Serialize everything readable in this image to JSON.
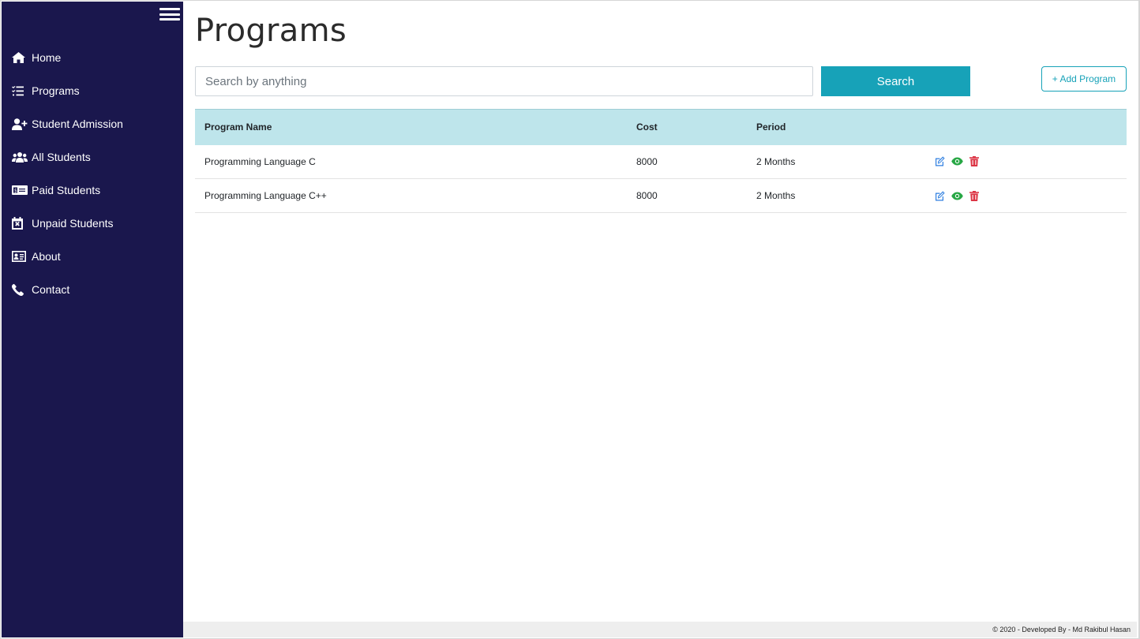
{
  "sidebar": {
    "items": [
      {
        "label": "Home",
        "icon": "home-icon"
      },
      {
        "label": "Programs",
        "icon": "list-check-icon"
      },
      {
        "label": "Student Admission",
        "icon": "user-plus-icon"
      },
      {
        "label": "All Students",
        "icon": "users-icon"
      },
      {
        "label": "Paid Students",
        "icon": "money-bill-icon"
      },
      {
        "label": "Unpaid Students",
        "icon": "calendar-times-icon"
      },
      {
        "label": "About",
        "icon": "id-card-icon"
      },
      {
        "label": "Contact",
        "icon": "phone-icon"
      }
    ]
  },
  "main": {
    "title": "Programs",
    "search": {
      "placeholder": "Search by anything",
      "value": "",
      "button_label": "Search"
    },
    "add_button_label": "+ Add Program",
    "table": {
      "columns": [
        "Program Name",
        "Cost",
        "Period",
        ""
      ],
      "rows": [
        {
          "name": "Programming Language C",
          "cost": "8000",
          "period": "2 Months"
        },
        {
          "name": "Programming Language C++",
          "cost": "8000",
          "period": "2 Months"
        }
      ]
    }
  },
  "footer": {
    "text": "© 2020 - Developed By - Md Rakibul Hasan"
  },
  "colors": {
    "sidebar_bg": "#1a174d",
    "accent": "#17a2b8",
    "header_bg": "#bee5eb",
    "edit": "#2f7fe0",
    "view": "#28a745",
    "delete": "#dc3545"
  }
}
